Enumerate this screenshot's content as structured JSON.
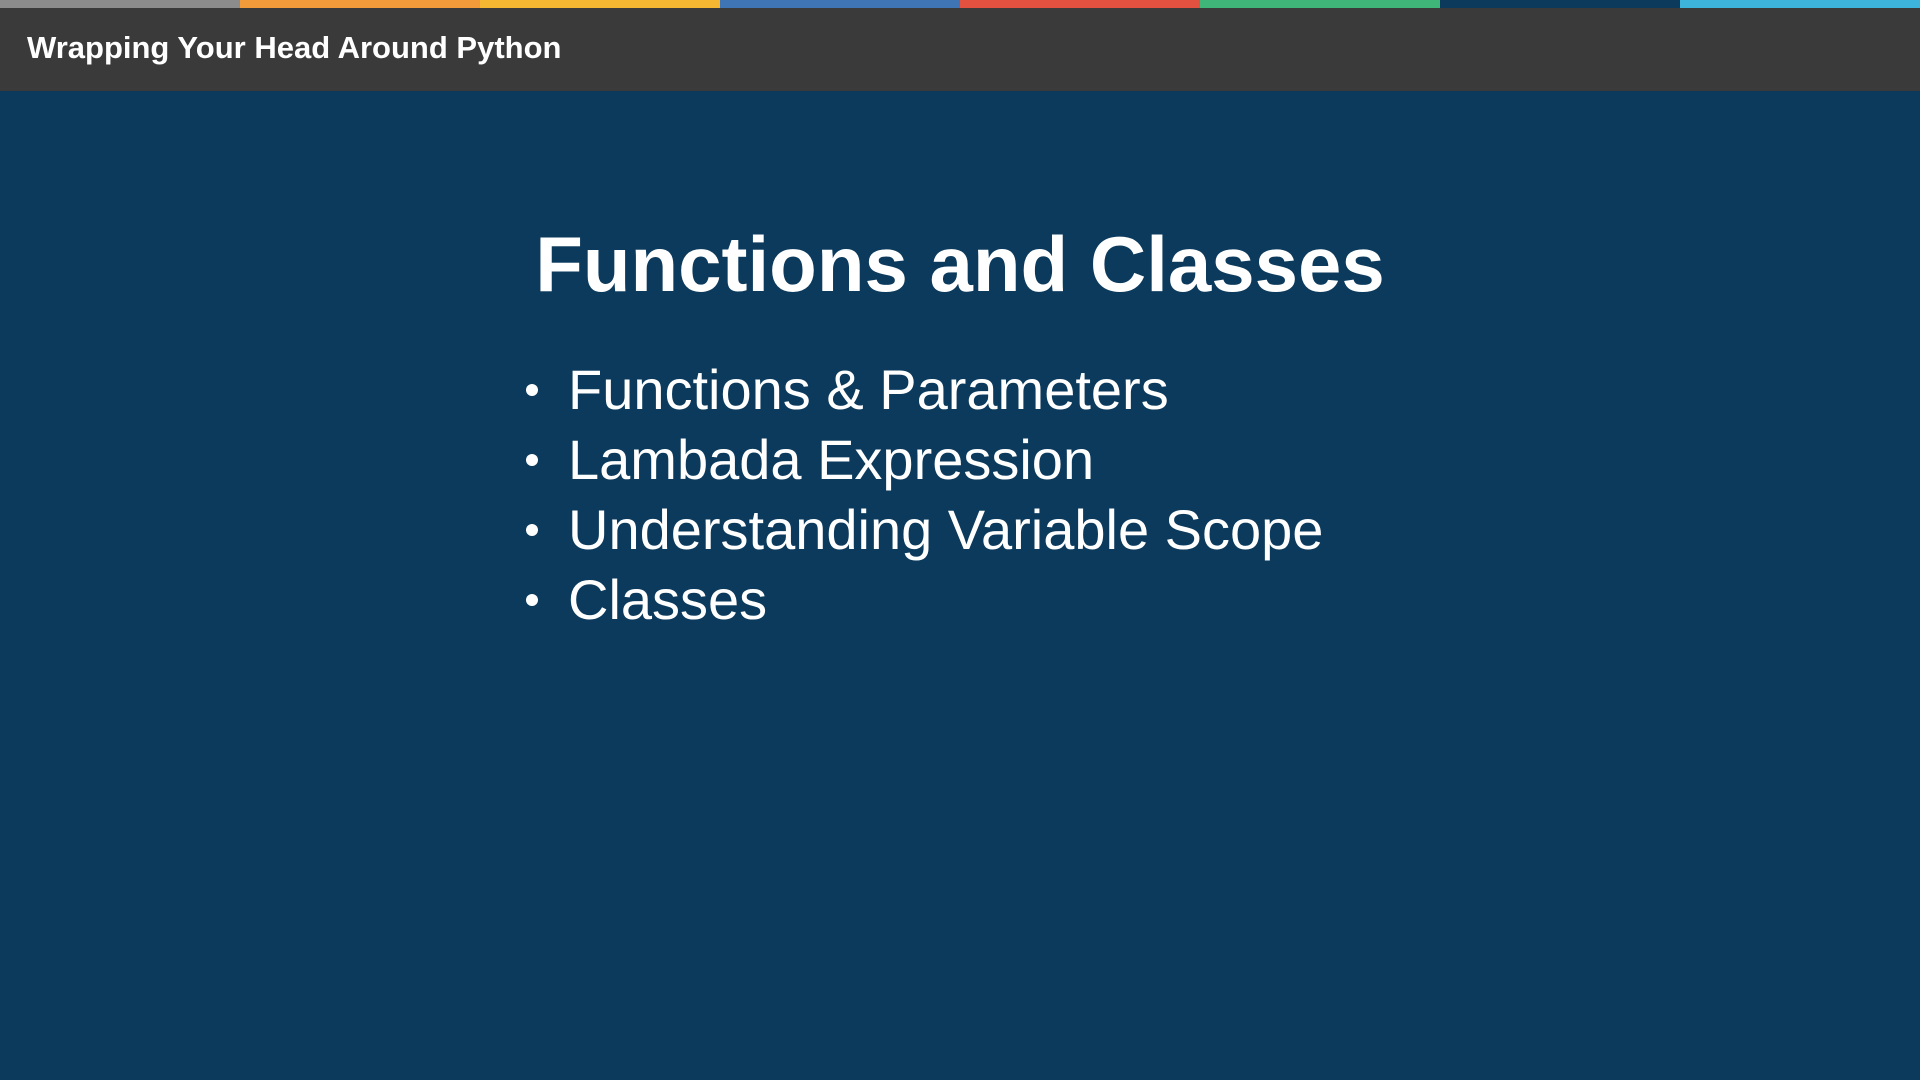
{
  "header": {
    "title": "Wrapping Your Head Around Python",
    "strip_colors": [
      "#8c8c8c",
      "#f39a3a",
      "#f5b731",
      "#3f74b5",
      "#e2503f",
      "#3fb57a",
      "#0b3a5c",
      "#3db4dc"
    ]
  },
  "slide": {
    "title": "Functions and Classes",
    "bullets": [
      "Functions & Parameters",
      "Lambada Expression",
      "Understanding Variable Scope",
      "Classes"
    ]
  },
  "colors": {
    "background": "#0b3a5c",
    "header_bar": "#3a3a3a",
    "text": "#ffffff"
  }
}
